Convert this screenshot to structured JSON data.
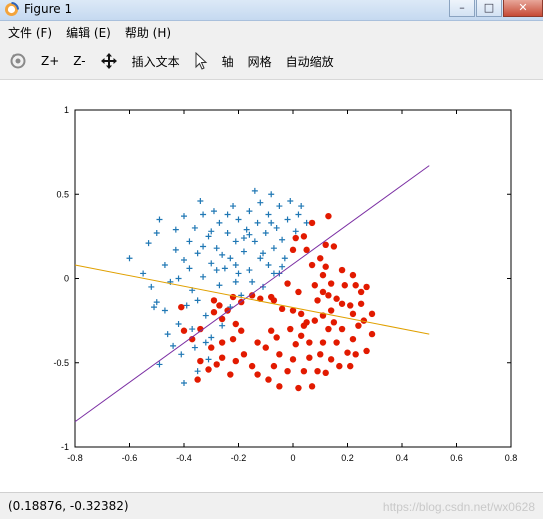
{
  "window": {
    "title": "Figure 1",
    "controls": {
      "minimize": "–",
      "maximize": "□",
      "close": "✕"
    }
  },
  "menu": [
    {
      "label": "文件 (F)"
    },
    {
      "label": "编辑 (E)"
    },
    {
      "label": "帮助 (H)"
    }
  ],
  "toolbar": {
    "zoom_in": "Z+",
    "zoom_out": "Z-",
    "insert_text": "插入文本",
    "axis": "轴",
    "grid": "网格",
    "autoscale": "自动缩放"
  },
  "status": {
    "coordinates": "(0.18876, -0.32382)",
    "watermark": "https://blog.csdn.net/wx0628"
  },
  "colors": {
    "plus_marker": "#1f77b4",
    "circle_marker": "#e21a00",
    "line_purple": "#7b2fa3",
    "line_orange": "#e0a000"
  },
  "chart_data": {
    "type": "scatter",
    "xlim": [
      -0.8,
      0.8
    ],
    "ylim": [
      -1,
      1
    ],
    "x_ticks": [
      "-0.8",
      "-0.6",
      "-0.4",
      "-0.2",
      "0",
      "0.2",
      "0.4",
      "0.6",
      "0.8"
    ],
    "y_ticks": [
      "-1",
      "-0.5",
      "0",
      "0.5",
      "1"
    ],
    "grid": false,
    "series": [
      {
        "marker": "plus",
        "color": "#1f77b4",
        "points": [
          [
            -0.6,
            0.12
          ],
          [
            -0.55,
            0.03
          ],
          [
            -0.52,
            -0.05
          ],
          [
            -0.5,
            -0.14
          ],
          [
            -0.51,
            -0.17
          ],
          [
            -0.53,
            0.21
          ],
          [
            -0.5,
            0.27
          ],
          [
            -0.49,
            0.35
          ],
          [
            -0.47,
            0.08
          ],
          [
            -0.45,
            -0.02
          ],
          [
            -0.43,
            0.17
          ],
          [
            -0.43,
            0.29
          ],
          [
            -0.42,
            0.0
          ],
          [
            -0.42,
            -0.27
          ],
          [
            -0.4,
            0.11
          ],
          [
            -0.4,
            0.37
          ],
          [
            -0.38,
            0.06
          ],
          [
            -0.38,
            0.22
          ],
          [
            -0.37,
            -0.07
          ],
          [
            -0.37,
            -0.3
          ],
          [
            -0.36,
            0.3
          ],
          [
            -0.35,
            0.15
          ],
          [
            -0.35,
            -0.13
          ],
          [
            -0.34,
            0.46
          ],
          [
            -0.33,
            0.38
          ],
          [
            -0.33,
            0.01
          ],
          [
            -0.32,
            -0.22
          ],
          [
            -0.31,
            0.25
          ],
          [
            -0.3,
            0.09
          ],
          [
            -0.3,
            -0.35
          ],
          [
            -0.29,
            0.4
          ],
          [
            -0.28,
            0.18
          ],
          [
            -0.27,
            -0.04
          ],
          [
            -0.27,
            0.33
          ],
          [
            -0.26,
            -0.28
          ],
          [
            -0.25,
            0.06
          ],
          [
            -0.24,
            0.27
          ],
          [
            -0.23,
            0.12
          ],
          [
            -0.23,
            -0.17
          ],
          [
            -0.22,
            0.43
          ],
          [
            -0.21,
            0.22
          ],
          [
            -0.2,
            0.35
          ],
          [
            -0.2,
            0.03
          ],
          [
            -0.19,
            -0.1
          ],
          [
            -0.18,
            0.16
          ],
          [
            -0.17,
            0.29
          ],
          [
            -0.16,
            0.4
          ],
          [
            -0.16,
            0.05
          ],
          [
            -0.15,
            -0.02
          ],
          [
            -0.14,
            0.22
          ],
          [
            -0.14,
            0.52
          ],
          [
            -0.13,
            0.33
          ],
          [
            -0.12,
            0.12
          ],
          [
            -0.12,
            0.45
          ],
          [
            -0.11,
            -0.05
          ],
          [
            -0.1,
            0.27
          ],
          [
            -0.09,
            0.08
          ],
          [
            -0.09,
            0.38
          ],
          [
            -0.08,
            0.5
          ],
          [
            -0.07,
            0.18
          ],
          [
            -0.06,
            0.3
          ],
          [
            -0.05,
            0.03
          ],
          [
            -0.05,
            0.43
          ],
          [
            -0.04,
            0.23
          ],
          [
            -0.03,
            0.12
          ],
          [
            -0.02,
            0.35
          ],
          [
            -0.01,
            0.46
          ],
          [
            0.01,
            0.28
          ],
          [
            0.03,
            0.43
          ],
          [
            0.05,
            0.33
          ],
          [
            -0.33,
            0.19
          ],
          [
            -0.39,
            -0.16
          ],
          [
            -0.47,
            -0.19
          ],
          [
            -0.44,
            -0.4
          ],
          [
            -0.41,
            -0.45
          ],
          [
            -0.46,
            -0.33
          ],
          [
            -0.36,
            -0.41
          ],
          [
            -0.32,
            -0.38
          ],
          [
            -0.31,
            -0.48
          ],
          [
            -0.28,
            0.05
          ],
          [
            -0.21,
            -0.02
          ],
          [
            -0.26,
            0.14
          ],
          [
            -0.18,
            0.24
          ],
          [
            -0.11,
            0.15
          ],
          [
            -0.07,
            0.03
          ],
          [
            -0.24,
            0.38
          ],
          [
            -0.3,
            0.28
          ],
          [
            -0.16,
            0.26
          ],
          [
            -0.04,
            0.07
          ],
          [
            0.02,
            0.38
          ],
          [
            -0.49,
            -0.51
          ],
          [
            -0.4,
            -0.62
          ],
          [
            -0.35,
            -0.55
          ],
          [
            -0.08,
            0.33
          ],
          [
            -0.21,
            0.08
          ]
        ]
      },
      {
        "marker": "circle",
        "color": "#e21a00",
        "points": [
          [
            0.13,
            0.37
          ],
          [
            0.07,
            0.33
          ],
          [
            0.12,
            0.2
          ],
          [
            0.15,
            0.19
          ],
          [
            0.04,
            0.25
          ],
          [
            0.01,
            0.24
          ],
          [
            0.0,
            0.17
          ],
          [
            0.07,
            0.08
          ],
          [
            0.12,
            0.07
          ],
          [
            0.11,
            0.02
          ],
          [
            0.18,
            0.05
          ],
          [
            0.14,
            -0.03
          ],
          [
            -0.02,
            -0.03
          ],
          [
            0.02,
            -0.08
          ],
          [
            0.08,
            -0.04
          ],
          [
            0.11,
            -0.08
          ],
          [
            0.13,
            -0.1
          ],
          [
            0.16,
            -0.12
          ],
          [
            0.19,
            -0.04
          ],
          [
            0.23,
            -0.04
          ],
          [
            0.25,
            -0.08
          ],
          [
            0.25,
            -0.15
          ],
          [
            0.21,
            -0.16
          ],
          [
            0.18,
            -0.15
          ],
          [
            0.14,
            -0.19
          ],
          [
            0.11,
            -0.22
          ],
          [
            0.08,
            -0.25
          ],
          [
            0.05,
            -0.26
          ],
          [
            0.03,
            -0.21
          ],
          [
            0.0,
            -0.19
          ],
          [
            -0.04,
            -0.18
          ],
          [
            -0.07,
            -0.13
          ],
          [
            -0.08,
            -0.11
          ],
          [
            -0.12,
            -0.12
          ],
          [
            -0.15,
            -0.1
          ],
          [
            -0.19,
            -0.14
          ],
          [
            -0.22,
            -0.11
          ],
          [
            -0.24,
            -0.19
          ],
          [
            -0.27,
            -0.16
          ],
          [
            -0.29,
            -0.13
          ],
          [
            -0.29,
            -0.2
          ],
          [
            -0.26,
            -0.24
          ],
          [
            -0.21,
            -0.27
          ],
          [
            -0.19,
            -0.31
          ],
          [
            -0.22,
            -0.36
          ],
          [
            -0.26,
            -0.38
          ],
          [
            -0.3,
            -0.41
          ],
          [
            -0.34,
            -0.3
          ],
          [
            -0.37,
            -0.36
          ],
          [
            -0.4,
            -0.31
          ],
          [
            -0.41,
            -0.17
          ],
          [
            -0.34,
            -0.49
          ],
          [
            -0.35,
            -0.6
          ],
          [
            -0.31,
            -0.54
          ],
          [
            -0.28,
            -0.51
          ],
          [
            -0.26,
            -0.47
          ],
          [
            -0.23,
            -0.57
          ],
          [
            -0.21,
            -0.49
          ],
          [
            -0.18,
            -0.45
          ],
          [
            -0.15,
            -0.52
          ],
          [
            -0.13,
            -0.57
          ],
          [
            -0.13,
            -0.38
          ],
          [
            -0.1,
            -0.41
          ],
          [
            -0.08,
            -0.31
          ],
          [
            -0.06,
            -0.35
          ],
          [
            -0.05,
            -0.45
          ],
          [
            -0.07,
            -0.52
          ],
          [
            -0.09,
            -0.6
          ],
          [
            -0.05,
            -0.64
          ],
          [
            -0.02,
            -0.55
          ],
          [
            0.0,
            -0.48
          ],
          [
            0.01,
            -0.39
          ],
          [
            -0.01,
            -0.3
          ],
          [
            0.03,
            -0.34
          ],
          [
            0.04,
            -0.28
          ],
          [
            0.06,
            -0.38
          ],
          [
            0.06,
            -0.47
          ],
          [
            0.04,
            -0.55
          ],
          [
            0.02,
            -0.65
          ],
          [
            0.07,
            -0.64
          ],
          [
            0.09,
            -0.55
          ],
          [
            0.1,
            -0.45
          ],
          [
            0.11,
            -0.38
          ],
          [
            0.13,
            -0.3
          ],
          [
            0.15,
            -0.26
          ],
          [
            0.18,
            -0.3
          ],
          [
            0.16,
            -0.38
          ],
          [
            0.14,
            -0.48
          ],
          [
            0.12,
            -0.56
          ],
          [
            0.17,
            -0.52
          ],
          [
            0.2,
            -0.44
          ],
          [
            0.22,
            -0.36
          ],
          [
            0.24,
            -0.28
          ],
          [
            0.22,
            -0.21
          ],
          [
            0.26,
            -0.25
          ],
          [
            0.29,
            -0.33
          ],
          [
            0.29,
            -0.21
          ],
          [
            0.27,
            -0.05
          ],
          [
            0.22,
            0.02
          ],
          [
            0.23,
            -0.45
          ],
          [
            0.27,
            -0.43
          ],
          [
            0.21,
            -0.52
          ],
          [
            0.1,
            0.12
          ],
          [
            0.05,
            0.17
          ],
          [
            0.09,
            -0.13
          ]
        ]
      },
      {
        "marker": "line",
        "color": "#7b2fa3",
        "points": [
          [
            -0.8,
            -0.85
          ],
          [
            0.5,
            0.67
          ]
        ]
      },
      {
        "marker": "line",
        "color": "#e0a000",
        "points": [
          [
            -0.8,
            0.08
          ],
          [
            0.5,
            -0.33
          ]
        ]
      }
    ]
  }
}
